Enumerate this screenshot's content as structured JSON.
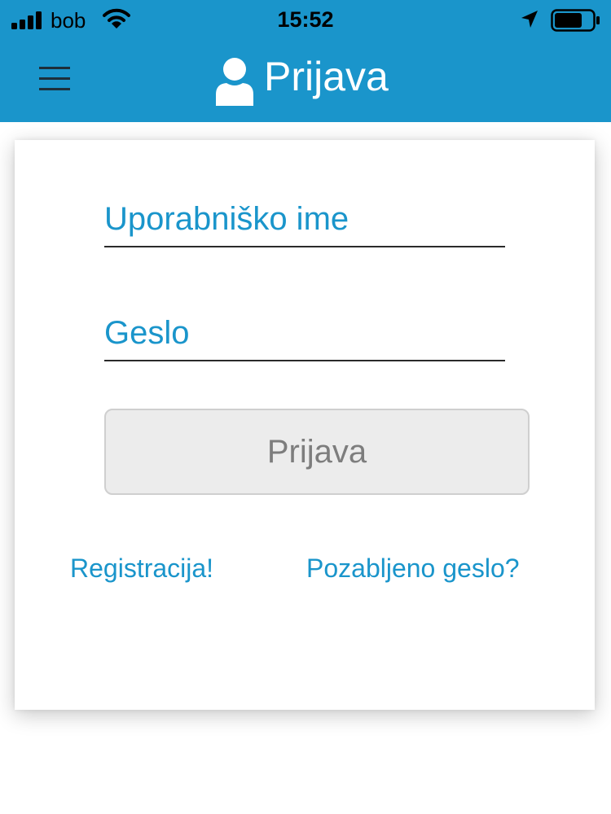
{
  "status_bar": {
    "carrier": "bob",
    "time": "15:52",
    "icons": [
      "signal-icon",
      "wifi-icon",
      "location-arrow-icon",
      "battery-icon"
    ]
  },
  "nav": {
    "title": "Prijava",
    "menu_icon": "hamburger-menu-icon",
    "title_icon": "user-icon"
  },
  "form": {
    "username_placeholder": "Uporabniško ime",
    "username_value": "",
    "password_placeholder": "Geslo",
    "password_value": "",
    "login_label": "Prijava"
  },
  "links": {
    "register": "Registracija!",
    "forgot_password": "Pozabljeno geslo?"
  },
  "colors": {
    "brand": "#1a95cb",
    "button_bg": "#ececec",
    "button_text": "#7d7d7d"
  }
}
